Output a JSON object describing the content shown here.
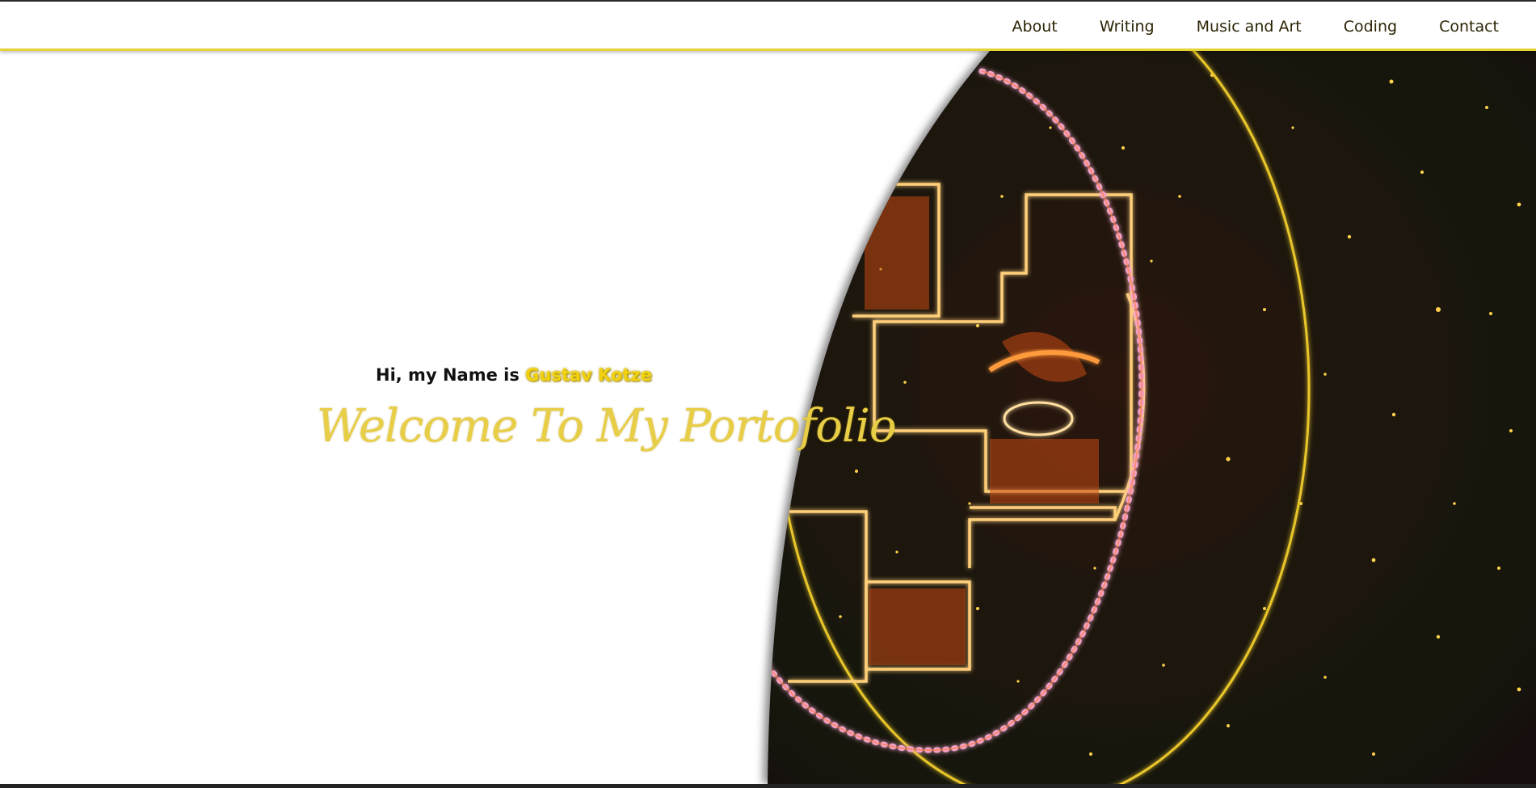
{
  "nav": {
    "items": [
      {
        "label": "About"
      },
      {
        "label": "Writing"
      },
      {
        "label": "Music and Art"
      },
      {
        "label": "Coding"
      },
      {
        "label": "Contact"
      }
    ]
  },
  "hero": {
    "intro_prefix": "Hi, my Name is",
    "name": "Gustav Kotze",
    "welcome": "Welcome To My Portofolio"
  },
  "colors": {
    "accent": "#e4d437",
    "name_highlight": "#f2d20f",
    "welcome_text": "#e8cd46",
    "art_background": "#1a1410",
    "art_glow": "#ff8a1e"
  }
}
